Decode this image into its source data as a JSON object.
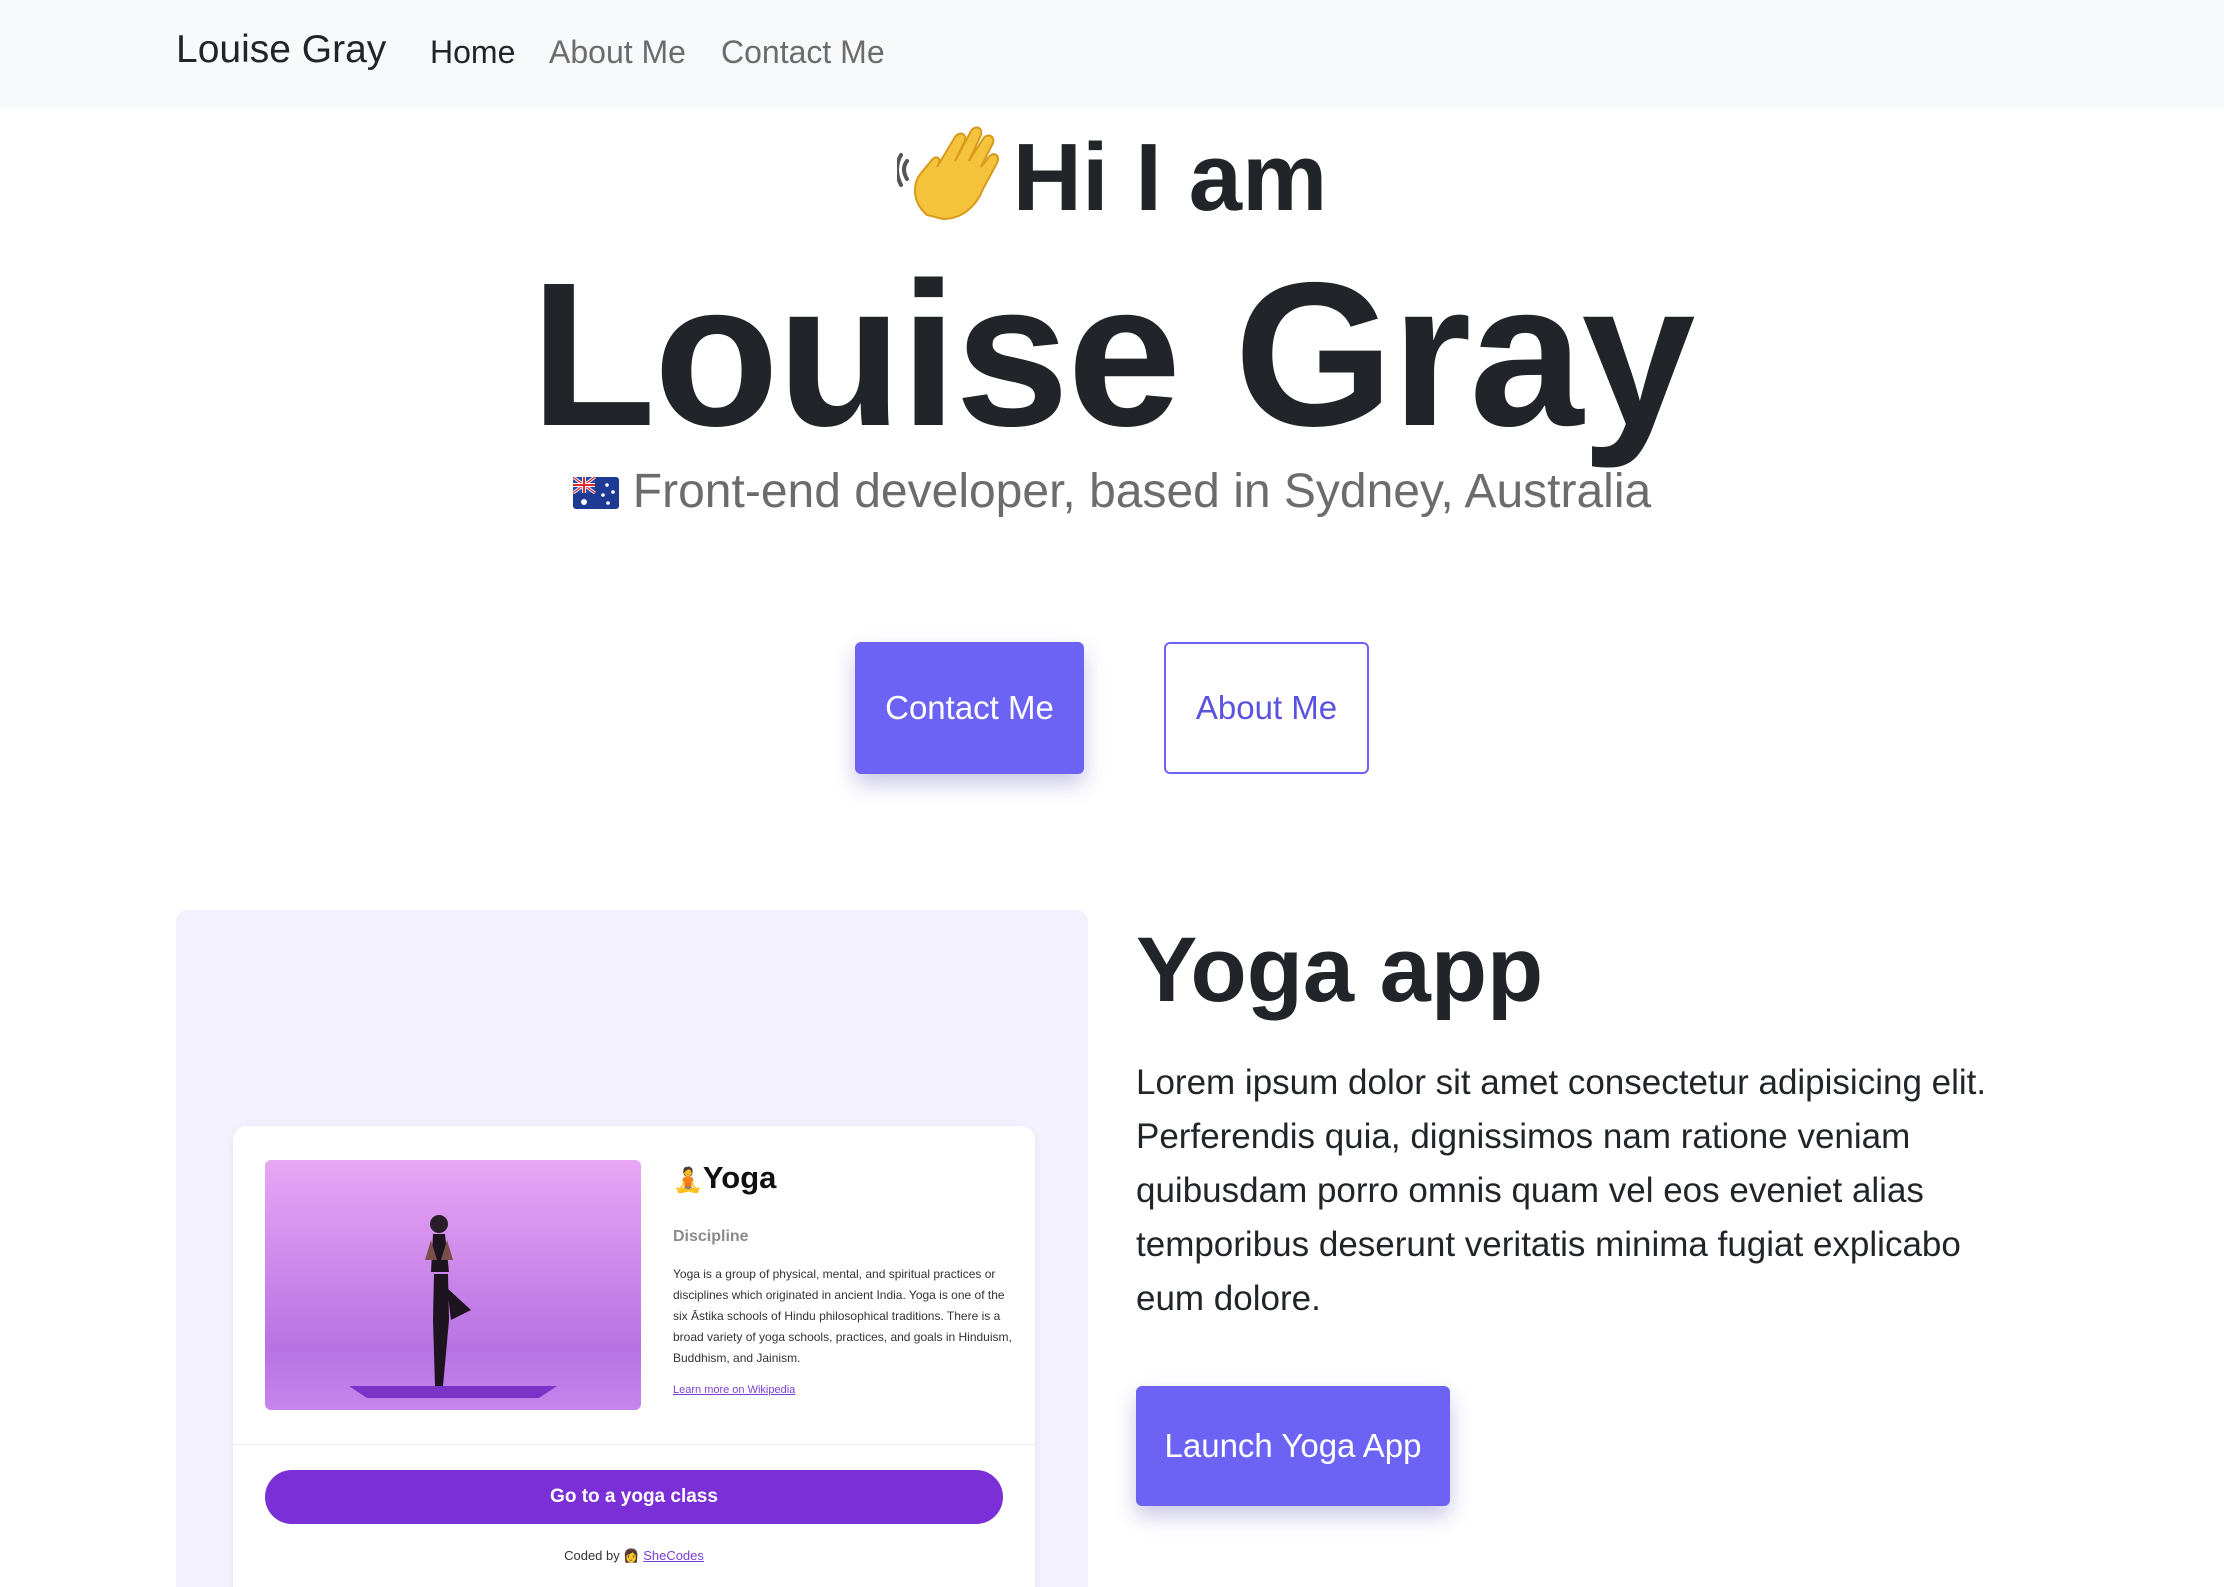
{
  "navbar": {
    "brand": "Louise Gray",
    "links": [
      {
        "label": "Home",
        "active": true
      },
      {
        "label": "About Me",
        "active": false
      },
      {
        "label": "Contact Me",
        "active": false
      }
    ]
  },
  "hero": {
    "wave_emoji": "👋",
    "greeting": "Hi I am",
    "name": "Louise Gray",
    "flag_icon": "australia-flag-icon",
    "tagline": "Front-end developer, based in Sydney, Australia",
    "contact_button": "Contact Me",
    "about_button": "About Me"
  },
  "project": {
    "title": "Yoga app",
    "description": "Lorem ipsum dolor sit amet consectetur adipisicing elit. Perferendis quia, dignissimos nam ratione veniam quibusdam porro omnis quam vel eos eveniet alias temporibus deserunt veritatis minima fugiat explicabo eum dolore.",
    "launch_button": "Launch Yoga App",
    "preview": {
      "title_emoji": "🧘",
      "title": "Yoga",
      "subtitle": "Discipline",
      "text": "Yoga is a group of physical, mental, and spiritual practices or disciplines which originated in ancient India. Yoga is one of the six Āstika schools of Hindu philosophical traditions. There is a broad variety of yoga schools, practices, and goals in Hinduism, Buddhism, and Jainism.",
      "link": "Learn more on Wikipedia",
      "button": "Go to a yoga class",
      "credit_prefix": "Coded by",
      "credit_emoji": "👩",
      "credit_link": "SheCodes"
    }
  },
  "colors": {
    "accent": "#6c63f5",
    "navbar_bg": "#f8f9fa",
    "preview_bg": "#f3f1fd",
    "yoga_purple": "#7b2fd6"
  }
}
